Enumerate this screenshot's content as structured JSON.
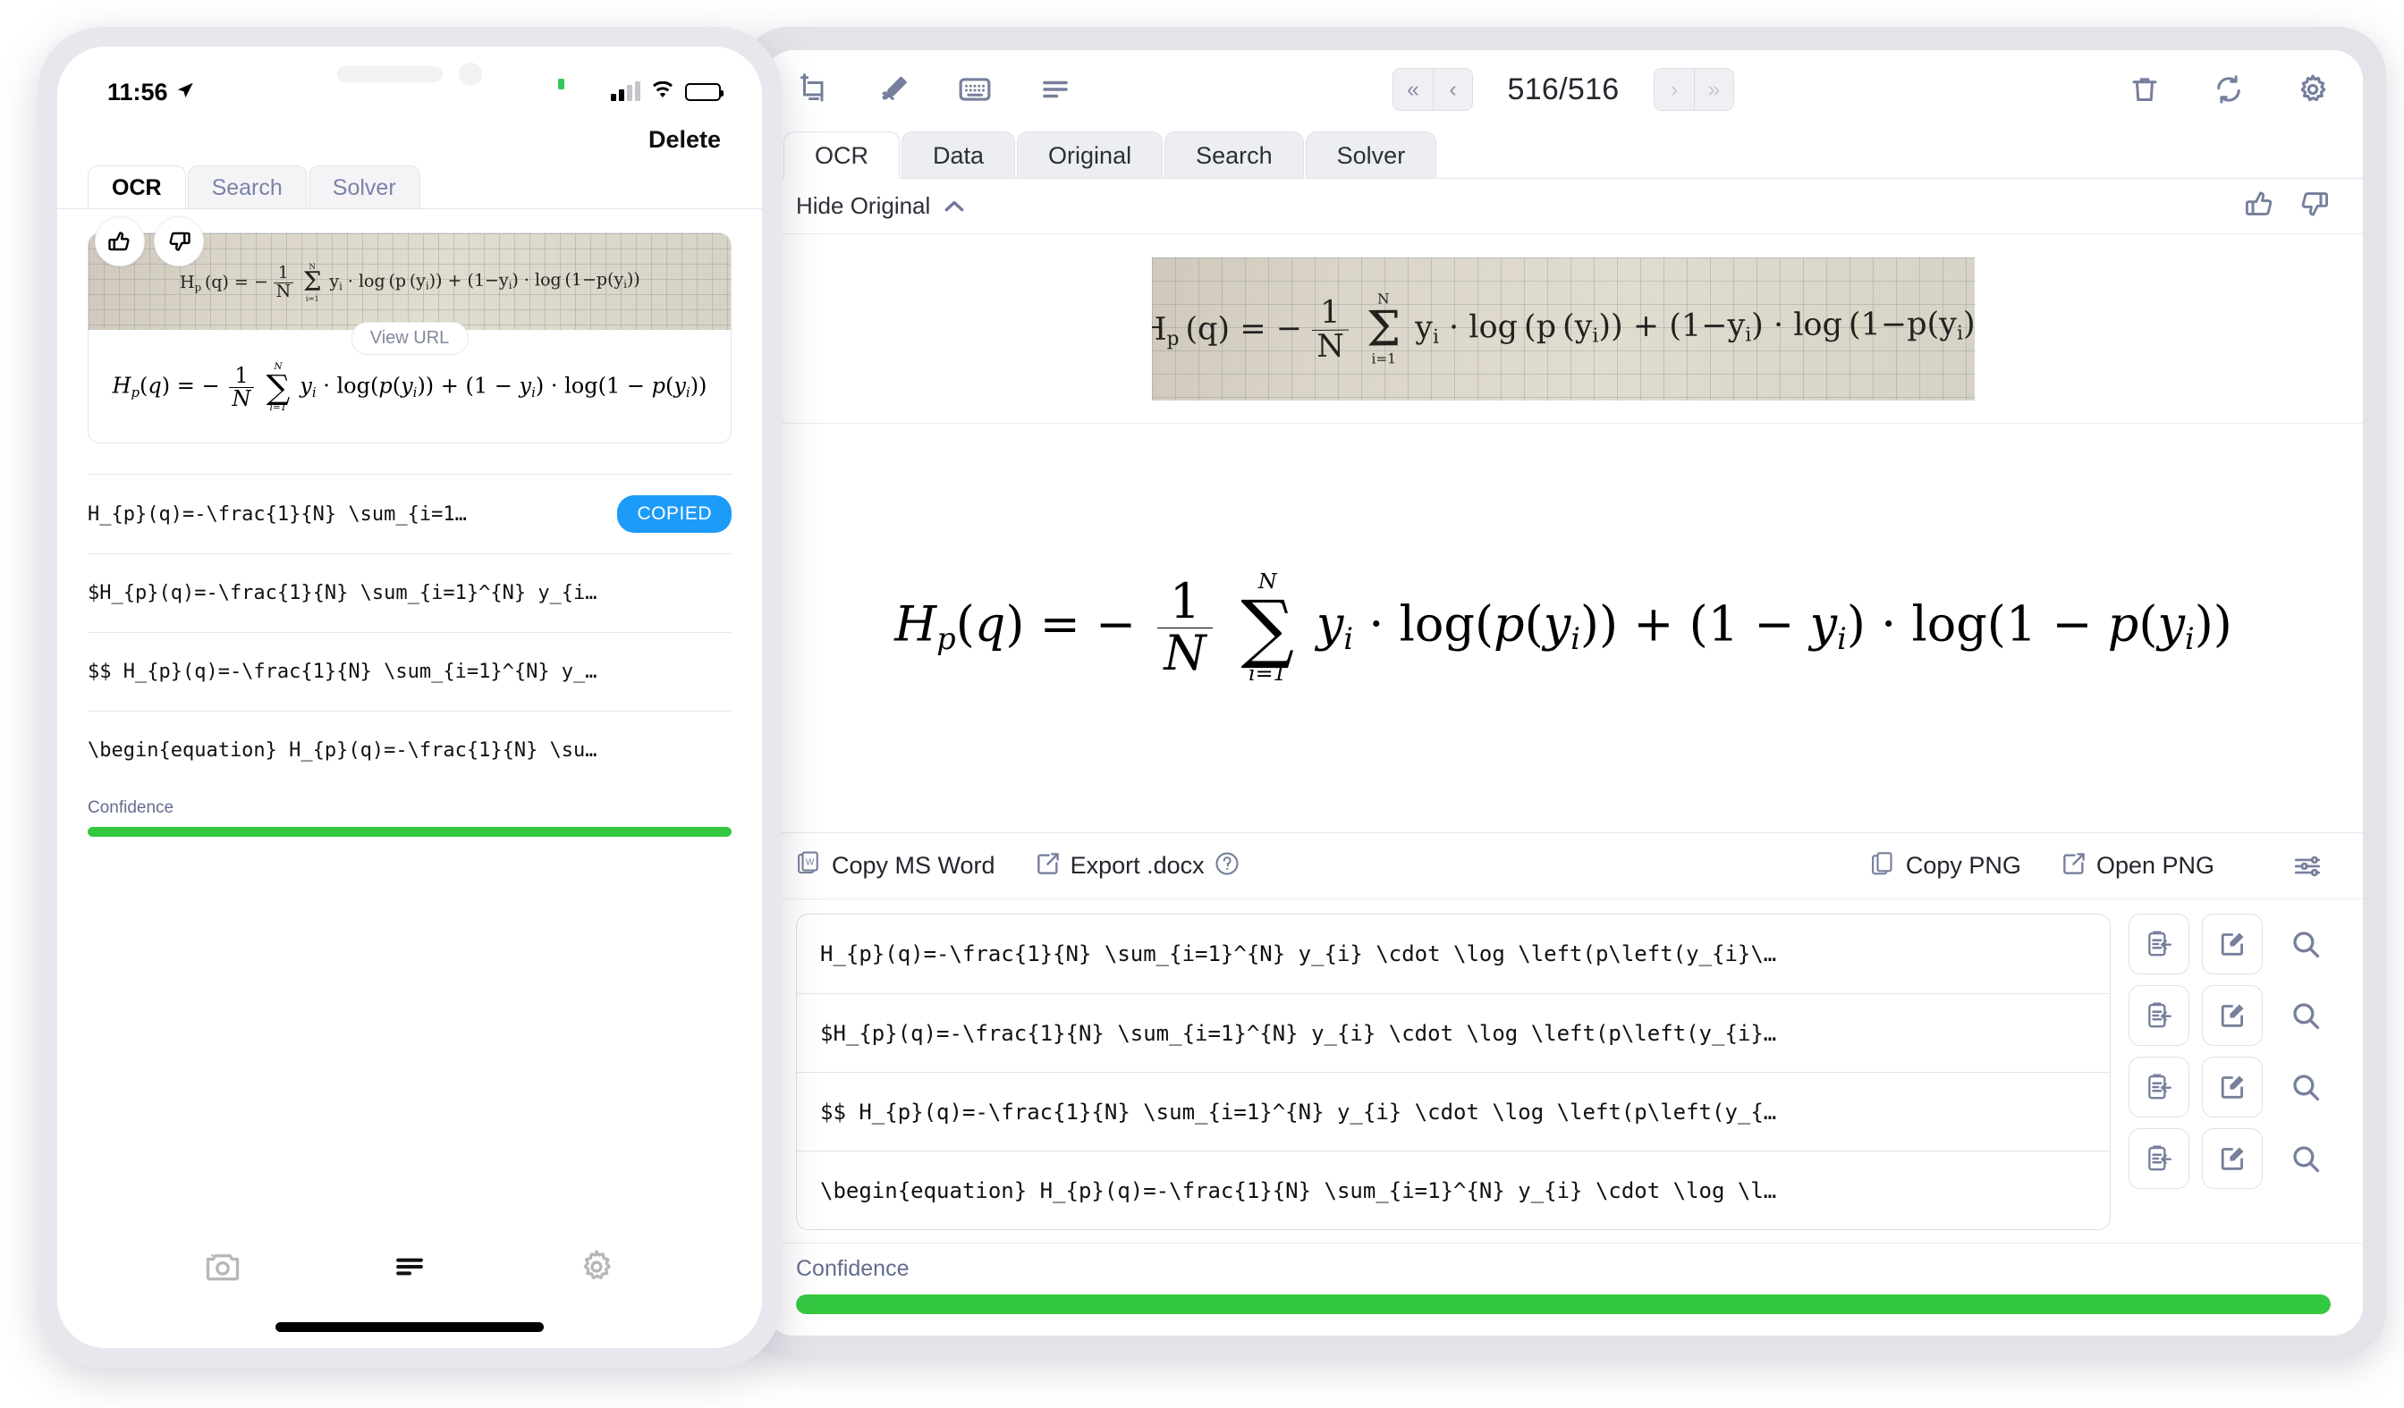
{
  "tablet": {
    "toolbar": {
      "icons": [
        {
          "name": "crop-add-icon",
          "label": "Crop / Add Screenshot"
        },
        {
          "name": "pen-edit-icon",
          "label": "Draw"
        },
        {
          "name": "keyboard-icon",
          "label": "Keyboard"
        },
        {
          "name": "list-lines-icon",
          "label": "History"
        }
      ],
      "pager": {
        "first_label": "«",
        "prev_label": "‹",
        "count": "516/516",
        "next_label": "›",
        "last_label": "»"
      },
      "right_icons": [
        {
          "name": "trash-icon",
          "label": "Delete"
        },
        {
          "name": "sync-icon",
          "label": "Refresh"
        },
        {
          "name": "gear-icon",
          "label": "Settings"
        }
      ]
    },
    "tabs": [
      {
        "label": "OCR",
        "active": true
      },
      {
        "label": "Data",
        "active": false
      },
      {
        "label": "Original",
        "active": false
      },
      {
        "label": "Search",
        "active": false
      },
      {
        "label": "Solver",
        "active": false
      }
    ],
    "hide_row": {
      "label": "Hide Original",
      "chevron": "chevron-up-icon",
      "thumbs_up": "thumbs-up-icon",
      "thumbs_down": "thumbs-down-icon"
    },
    "original_image": {
      "alt": "Handwritten binary cross-entropy formula on graph paper"
    },
    "export_bar": {
      "copy_ms_word": "Copy MS Word",
      "export_docx": "Export .docx",
      "help": "?",
      "copy_png": "Copy PNG",
      "open_png": "Open PNG",
      "settings": "sliders-icon"
    },
    "latex_rows": [
      "H_{p}(q)=-\\frac{1}{N} \\sum_{i=1}^{N} y_{i} \\cdot \\log \\left(p\\left(y_{i}\\…",
      "$H_{p}(q)=-\\frac{1}{N} \\sum_{i=1}^{N} y_{i} \\cdot \\log \\left(p\\left(y_{i}…",
      "$$ H_{p}(q)=-\\frac{1}{N} \\sum_{i=1}^{N} y_{i} \\cdot \\log \\left(p\\left(y_{…",
      "\\begin{equation} H_{p}(q)=-\\frac{1}{N} \\sum_{i=1}^{N} y_{i} \\cdot \\log \\l…"
    ],
    "row_actions": [
      {
        "name": "copy-to-clipboard-icon"
      },
      {
        "name": "edit-icon"
      },
      {
        "name": "search-icon"
      }
    ],
    "confidence": {
      "label": "Confidence",
      "percent": 100,
      "color": "#34c840"
    }
  },
  "phone": {
    "status": {
      "time": "11:56",
      "location_icon": "location-arrow-icon",
      "signal_icon": "cellular-bars-icon",
      "wifi_icon": "wifi-icon",
      "battery_icon": "battery-icon"
    },
    "delete_label": "Delete",
    "tabs": [
      {
        "label": "OCR",
        "active": true
      },
      {
        "label": "Search",
        "active": false
      },
      {
        "label": "Solver",
        "active": false
      }
    ],
    "feedback": {
      "thumbs_up": "thumbs-up-icon",
      "thumbs_down": "thumbs-down-icon"
    },
    "view_url_label": "View URL",
    "latex_rows": [
      {
        "text": "H_{p}(q)=-\\frac{1}{N} \\sum_{i=1…",
        "badge": "COPIED"
      },
      {
        "text": "$H_{p}(q)=-\\frac{1}{N} \\sum_{i=1}^{N} y_{i…",
        "badge": ""
      },
      {
        "text": "$$ H_{p}(q)=-\\frac{1}{N} \\sum_{i=1}^{N} y_…",
        "badge": ""
      },
      {
        "text": "\\begin{equation} H_{p}(q)=-\\frac{1}{N} \\su…",
        "badge": ""
      }
    ],
    "confidence": {
      "label": "Confidence",
      "percent": 100,
      "color": "#34c840"
    },
    "bottom_tabs": [
      {
        "name": "camera-icon",
        "active": false
      },
      {
        "name": "list-lines-icon",
        "active": true
      },
      {
        "name": "gear-icon",
        "active": false
      }
    ]
  },
  "colors": {
    "accent_blue": "#1d9bf9",
    "confidence_green": "#34c840",
    "icon_slate": "#767f9c"
  }
}
